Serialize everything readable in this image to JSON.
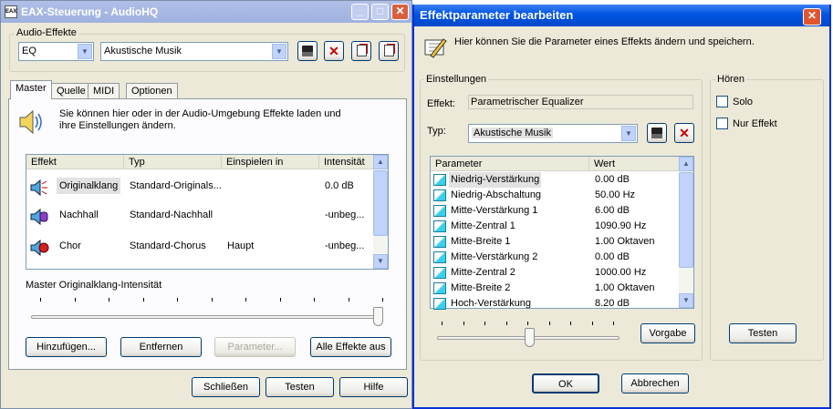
{
  "left_window": {
    "title": "EAX-Steuerung - AudioHQ",
    "audio_effects_label": "Audio-Effekte",
    "category_value": "EQ",
    "preset_value": "Akustische Musik",
    "tabs": [
      "Master",
      "Quelle",
      "MIDI",
      "Optionen"
    ],
    "info_text": "Sie können hier oder in der Audio-Umgebung Effekte laden und ihre Einstellungen ändern.",
    "columns": [
      "Effekt",
      "Typ",
      "Einspielen in",
      "Intensität"
    ],
    "rows": [
      {
        "effect": "Originalklang",
        "type": "Standard-Originals...",
        "route": "",
        "intensity": "0.0 dB"
      },
      {
        "effect": "Nachhall",
        "type": "Standard-Nachhall",
        "route": "",
        "intensity": "-unbeg..."
      },
      {
        "effect": "Chor",
        "type": "Standard-Chorus",
        "route": "Haupt",
        "intensity": "-unbeg..."
      }
    ],
    "slider_label": "Master Originalklang-Intensität",
    "slider_level_fraction": 1.0,
    "buttons": {
      "add": "Hinzufügen...",
      "remove": "Entfernen",
      "params": "Parameter...",
      "all_off": "Alle Effekte aus"
    },
    "bottom_buttons": {
      "close": "Schließen",
      "test": "Testen",
      "help": "Hilfe"
    }
  },
  "right_window": {
    "title": "Effektparameter bearbeiten",
    "info_text": "Hier können Sie die Parameter eines Effekts ändern und speichern.",
    "settings_label": "Einstellungen",
    "effect_label": "Effekt:",
    "effect_value": "Parametrischer Equalizer",
    "type_label": "Typ:",
    "type_value": "Akustische Musik",
    "param_columns": [
      "Parameter",
      "Wert"
    ],
    "params": [
      {
        "name": "Niedrig-Verstärkung",
        "value": "0.00 dB"
      },
      {
        "name": "Niedrig-Abschaltung",
        "value": "50.00 Hz"
      },
      {
        "name": "Mitte-Verstärkung 1",
        "value": "6.00 dB"
      },
      {
        "name": "Mitte-Zentral 1",
        "value": "1090.90 Hz"
      },
      {
        "name": "Mitte-Breite 1",
        "value": "1.00 Oktaven"
      },
      {
        "name": "Mitte-Verstärkung 2",
        "value": "0.00 dB"
      },
      {
        "name": "Mitte-Zentral 2",
        "value": "1000.00 Hz"
      },
      {
        "name": "Mitte-Breite 2",
        "value": "1.00 Oktaven"
      },
      {
        "name": "Hoch-Verstärkung",
        "value": "8.20 dB"
      }
    ],
    "slider_level_fraction": 0.4,
    "default_button": "Vorgabe",
    "hear_label": "Hören",
    "solo_label": "Solo",
    "effect_only_label": "Nur Effekt",
    "test_button": "Testen",
    "ok_button": "OK",
    "cancel_button": "Abbrechen"
  },
  "colors": {
    "titlebar_active": "#0054e3",
    "titlebar_inactive": "#9fb1df",
    "window_bg": "#ece9d8",
    "selection": "#e2e2e2"
  }
}
